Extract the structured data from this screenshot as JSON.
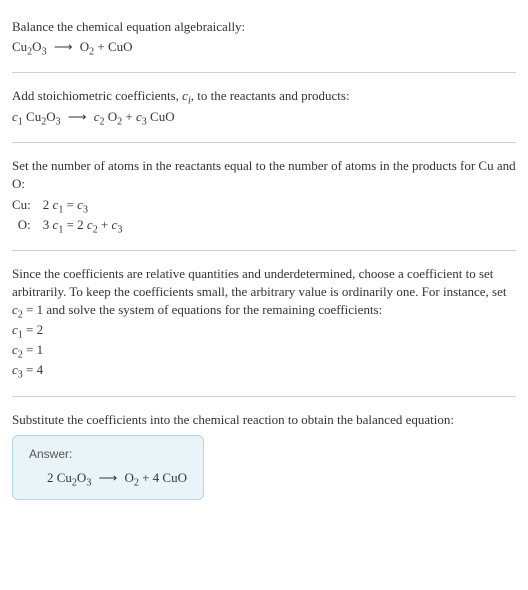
{
  "section1": {
    "line1": "Balance the chemical equation algebraically:",
    "eq_lhs": "Cu",
    "eq_lhs_sub1": "2",
    "eq_lhs_mid": "O",
    "eq_lhs_sub2": "3",
    "arrow": "⟶",
    "eq_rhs_a": "O",
    "eq_rhs_a_sub": "2",
    "plus": " + ",
    "eq_rhs_b": "CuO"
  },
  "section2": {
    "text_a": "Add stoichiometric coefficients, ",
    "ci_c": "c",
    "ci_i": "i",
    "text_b": ", to the reactants and products:",
    "c1": "c",
    "c1s": "1",
    "sp1": " Cu",
    "sp1s1": "2",
    "sp1o": "O",
    "sp1s2": "3",
    "arrow": "⟶",
    "c2": "c",
    "c2s": "2",
    "sp2": " O",
    "sp2s": "2",
    "plus": " + ",
    "c3": "c",
    "c3s": "3",
    "sp3": " CuO"
  },
  "section3": {
    "text": "Set the number of atoms in the reactants equal to the number of atoms in the products for Cu and O:",
    "rows": [
      {
        "el": "Cu:",
        "lhs_coef": "2 ",
        "lhs_c": "c",
        "lhs_s": "1",
        "eq": " = ",
        "rhs_c": "c",
        "rhs_s": "3",
        "rhs_extra": ""
      },
      {
        "el": "O:",
        "lhs_coef": "3 ",
        "lhs_c": "c",
        "lhs_s": "1",
        "eq": " = 2 ",
        "rhs_c": "c",
        "rhs_s": "2",
        "rhs_extra_pre": " + ",
        "rhs_c2": "c",
        "rhs_s2": "3"
      }
    ]
  },
  "section4": {
    "text_a": "Since the coefficients are relative quantities and underdetermined, choose a coefficient to set arbitrarily. To keep the coefficients small, the arbitrary value is ordinarily one. For instance, set ",
    "cset_c": "c",
    "cset_s": "2",
    "text_b": " = 1 and solve the system of equations for the remaining coefficients:",
    "sol": [
      {
        "c": "c",
        "s": "1",
        "v": " = 2"
      },
      {
        "c": "c",
        "s": "2",
        "v": " = 1"
      },
      {
        "c": "c",
        "s": "3",
        "v": " = 4"
      }
    ]
  },
  "section5": {
    "text": "Substitute the coefficients into the chemical reaction to obtain the balanced equation:",
    "answer_label": "Answer:",
    "ans_lhs_coef": "2 Cu",
    "ans_lhs_s1": "2",
    "ans_lhs_o": "O",
    "ans_lhs_s2": "3",
    "arrow": "⟶",
    "ans_rhs_a": "O",
    "ans_rhs_a_s": "2",
    "ans_plus": " + 4 CuO"
  },
  "chart_data": {
    "type": "table",
    "title": "Balancing Cu2O3 → O2 + CuO",
    "atom_balance": [
      {
        "element": "Cu",
        "reactants": "2 c1",
        "products": "c3"
      },
      {
        "element": "O",
        "reactants": "3 c1",
        "products": "2 c2 + c3"
      }
    ],
    "solution": {
      "c1": 2,
      "c2": 1,
      "c3": 4
    },
    "balanced_equation": "2 Cu2O3 ⟶ O2 + 4 CuO"
  }
}
